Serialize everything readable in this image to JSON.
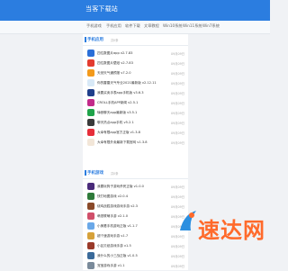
{
  "header": {
    "logo": "当客下载站"
  },
  "nav": {
    "items": [
      "手机游戏",
      "手机应用",
      "软件下载",
      "文章教程",
      "Win10系统",
      "Win11系统",
      "Win7系统"
    ]
  },
  "sections": [
    {
      "title": "手机应用",
      "count": "共0条",
      "items": [
        {
          "title": "四位数图片app v2.7.83",
          "date": "09月09日",
          "color": "#2b6fd8"
        },
        {
          "title": "四位数图片壁纸 v2.7.83",
          "date": "09月09日",
          "color": "#e33b2f"
        },
        {
          "title": "天然天气通预报 v7.2.0",
          "date": "09月09日",
          "color": "#f39a1c"
        },
        {
          "title": "你的雷雷天气专业2021最新版 v2.12.11",
          "date": "09月09日",
          "color": "#d8e9f7"
        },
        {
          "title": "我要买卖手表app手机版 v3.6.3",
          "date": "09月09日",
          "color": "#1f3f8b"
        },
        {
          "title": "CROLL手机APP新闻 v2.5.1",
          "date": "09月09日",
          "color": "#c22a8a"
        },
        {
          "title": "嗨音聊天app最新版 v3.5.1",
          "date": "09月09日",
          "color": "#1fa34a"
        },
        {
          "title": "聊天热点app手机 v5.2.1",
          "date": "09月09日",
          "color": "#3a3a3a"
        },
        {
          "title": "大幸有限app官方正版 v1.3.8",
          "date": "09月09日",
          "color": "#e62e3a"
        },
        {
          "title": "大幸有限外卖最新下载官网 v1.3.8",
          "date": "09月09日",
          "color": "#f2e6d8"
        }
      ]
    },
    {
      "title": "手机游戏",
      "count": "共0条",
      "items": [
        {
          "title": "我要玩狗子游戏杀死正版 v1.0.0",
          "date": "09月09日",
          "color": "#4a2b7a"
        },
        {
          "title": "快打地图游戏 v2.0.4",
          "date": "09月09日",
          "color": "#2e7a3a"
        },
        {
          "title": "绕鸡战胜游戏游戏手游 v2.3",
          "date": "09月09日",
          "color": "#8a4a2a"
        },
        {
          "title": "萌宠联萌手游 v2.1.0",
          "date": "09月09日",
          "color": "#d04f6a"
        },
        {
          "title": "小美看手机游戏正版 v1.1.7",
          "date": "09月09日",
          "color": "#6aa8e8"
        },
        {
          "title": "超个速游戏手游 v1.7",
          "date": "09月09日",
          "color": "#d6a13a"
        },
        {
          "title": "小区贝纸游戏手游 v1.5",
          "date": "09月09日",
          "color": "#9a3a2a"
        },
        {
          "title": "我什么的小三战正版 v1.0.5",
          "date": "09月09日",
          "color": "#3a6a9a"
        },
        {
          "title": "宠宝游戏手游 v1.1",
          "date": "09月09日",
          "color": "#7a8a9a"
        }
      ]
    }
  ],
  "watermark": {
    "text": "速达网",
    "color_primary": "#ff6a2b",
    "color_secondary": "#2b8fe0"
  }
}
